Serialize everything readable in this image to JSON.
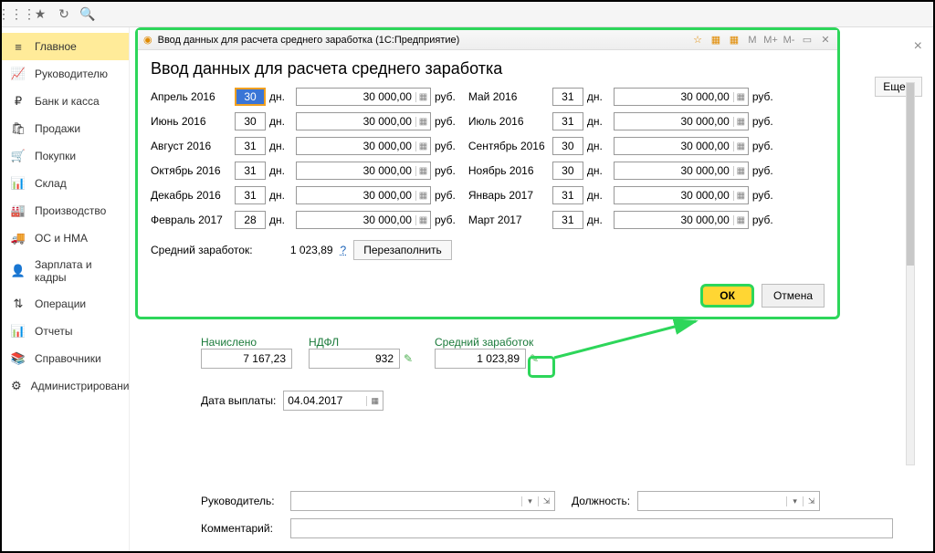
{
  "dialog": {
    "titlebar": "Ввод данных для расчета среднего заработка  (1С:Предприятие)",
    "heading": "Ввод данных для расчета среднего заработка",
    "dn": "дн.",
    "rub": "руб.",
    "rows": [
      {
        "m1": "Апрель 2016",
        "d1": "30",
        "a1": "30 000,00",
        "m2": "Май 2016",
        "d2": "31",
        "a2": "30 000,00"
      },
      {
        "m1": "Июнь 2016",
        "d1": "30",
        "a1": "30 000,00",
        "m2": "Июль 2016",
        "d2": "31",
        "a2": "30 000,00"
      },
      {
        "m1": "Август 2016",
        "d1": "31",
        "a1": "30 000,00",
        "m2": "Сентябрь 2016",
        "d2": "30",
        "a2": "30 000,00"
      },
      {
        "m1": "Октябрь 2016",
        "d1": "31",
        "a1": "30 000,00",
        "m2": "Ноябрь 2016",
        "d2": "30",
        "a2": "30 000,00"
      },
      {
        "m1": "Декабрь 2016",
        "d1": "31",
        "a1": "30 000,00",
        "m2": "Январь 2017",
        "d2": "31",
        "a2": "30 000,00"
      },
      {
        "m1": "Февраль 2017",
        "d1": "28",
        "a1": "30 000,00",
        "m2": "Март 2017",
        "d2": "31",
        "a2": "30 000,00"
      }
    ],
    "avg_label": "Средний заработок:",
    "avg_value": "1 023,89",
    "help": "?",
    "refill": "Перезаполнить",
    "ok": "ОК",
    "cancel": "Отмена"
  },
  "sidebar": {
    "items": [
      {
        "icon": "≡",
        "label": "Главное"
      },
      {
        "icon": "📈",
        "label": "Руководителю"
      },
      {
        "icon": "₽",
        "label": "Банк и касса"
      },
      {
        "icon": "🛍",
        "label": "Продажи"
      },
      {
        "icon": "🛒",
        "label": "Покупки"
      },
      {
        "icon": "📊",
        "label": "Склад"
      },
      {
        "icon": "🏭",
        "label": "Производство"
      },
      {
        "icon": "🚚",
        "label": "ОС и НМА"
      },
      {
        "icon": "👤",
        "label": "Зарплата и кадры"
      },
      {
        "icon": "⇅",
        "label": "Операции"
      },
      {
        "icon": "📊",
        "label": "Отчеты"
      },
      {
        "icon": "📚",
        "label": "Справочники"
      },
      {
        "icon": "⚙",
        "label": "Администрирование"
      }
    ]
  },
  "content": {
    "more": "Еще ▾",
    "accrued_label": "Начислено",
    "accrued_value": "7 167,23",
    "ndfl_label": "НДФЛ",
    "ndfl_value": "932",
    "avg_label": "Средний заработок",
    "avg_value": "1 023,89",
    "pay_date_label": "Дата выплаты:",
    "pay_date_value": "04.04.2017",
    "manager_label": "Руководитель:",
    "position_label": "Должность:",
    "comment_label": "Комментарий:"
  },
  "toolbar_mem": {
    "m": "M",
    "mplus": "M+",
    "mminus": "M-"
  }
}
